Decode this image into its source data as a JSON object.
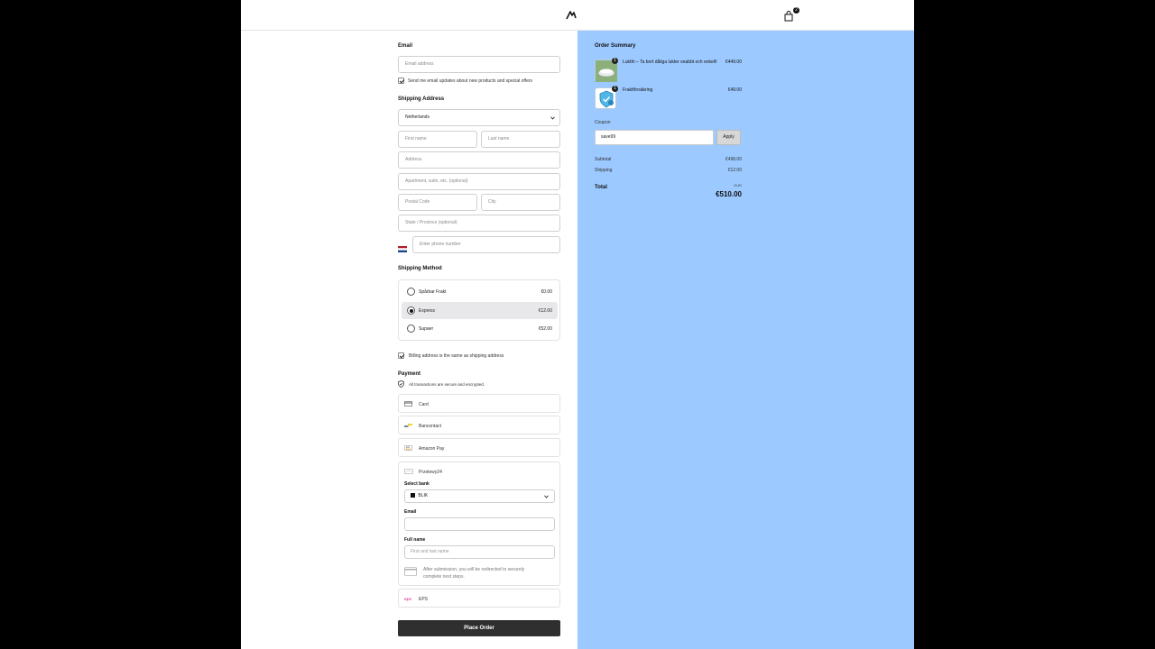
{
  "header": {
    "cart_count": "2"
  },
  "form": {
    "email_label": "Email",
    "email_placeholder": "Email address",
    "newsletter_label": "Send me email updates about new products and special offers",
    "shipping_address_label": "Shipping Address",
    "country_value": "Netherlands",
    "first_name_placeholder": "First name",
    "last_name_placeholder": "Last name",
    "address_placeholder": "Address",
    "apartment_placeholder": "Apartment, suite, etc. (optional)",
    "postal_placeholder": "Postal Code",
    "city_placeholder": "City",
    "state_placeholder": "State / Province (optional)",
    "phone_placeholder": "Enter phone number",
    "shipping_method_label": "Shipping Method",
    "shipping_options": [
      {
        "name": "Spårbar Frakt",
        "price": "€0.00"
      },
      {
        "name": "Express",
        "price": "€12.00"
      },
      {
        "name": "Supaer",
        "price": "€52.00"
      }
    ],
    "billing_same_label": "Billing address is the same as shipping address",
    "payment_label": "Payment",
    "secure_note": "All transactions are secure and encrypted.",
    "payment_methods": {
      "card": "Card",
      "bancontact": "Bancontact",
      "amazon": "Amazon Pay",
      "p24": "Przelewy24",
      "eps": "EPS"
    },
    "p24": {
      "select_bank_label": "Select bank",
      "bank_value": "BLIK",
      "email_label": "Email",
      "fullname_label": "Full name",
      "fullname_placeholder": "First and last name",
      "redirect_note": "After submission, you will be redirected to securely complete next steps."
    },
    "place_order": "Place Order"
  },
  "summary": {
    "title": "Order Summary",
    "items": [
      {
        "name": "Luktfri – Ta bort dåliga lukter snabbt och enkelt!",
        "price": "€449.00",
        "qty": "1"
      },
      {
        "name": "Fraktförsäkring",
        "price": "€49.00",
        "qty": "1"
      }
    ],
    "coupon_label": "Coupon",
    "coupon_value": "save99",
    "apply_label": "Apply",
    "subtotal_label": "Subtotal",
    "subtotal_value": "€498.00",
    "shipping_label": "Shipping",
    "shipping_value": "€12.00",
    "total_label": "Total",
    "currency": "EUR",
    "total_value": "€510.00"
  }
}
